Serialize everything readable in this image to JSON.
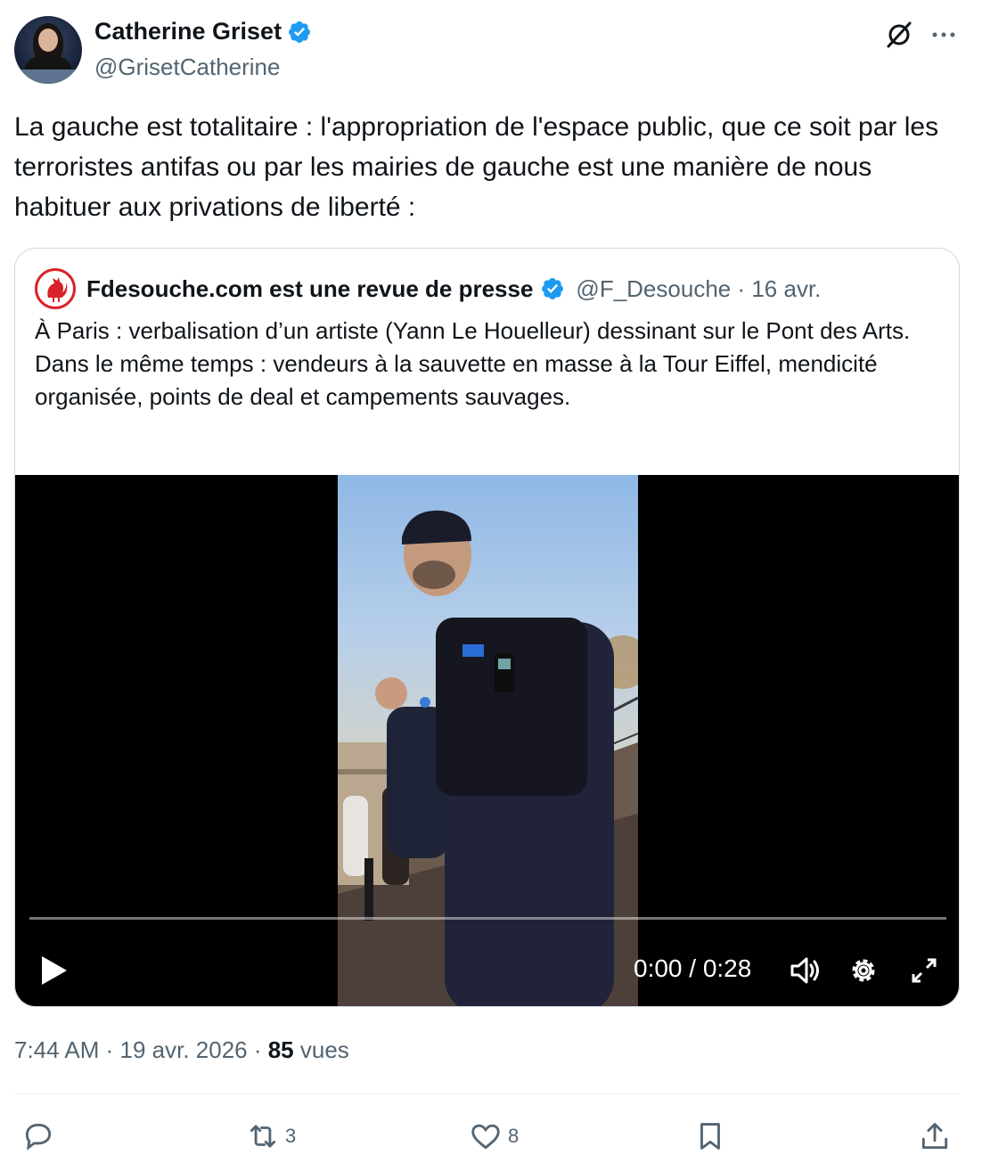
{
  "author": {
    "name": "Catherine Griset",
    "handle": "@GrisetCatherine"
  },
  "icons": {
    "verified": "verified-badge-icon",
    "grok": "grok-icon",
    "more": "more-options-icon"
  },
  "colors": {
    "verified": "#1d9bf0",
    "text_primary": "#0f1419",
    "text_secondary": "#536471",
    "border": "#cfd9de"
  },
  "tweet": {
    "text": "La gauche est totalitaire : l'appropriation de l'espace public, que ce soit par les terroristes antifas ou par les mairies de gauche est une manière de nous habituer aux privations de liberté :"
  },
  "quote": {
    "name": "Fdesouche.com est une revue de presse",
    "handle_date": "@F_Desouche · 16 avr.",
    "line1": "À Paris : verbalisation d’un artiste (Yann Le Houelleur) dessinant sur le Pont des Arts.",
    "line2": "Dans le même temps : vendeurs à la sauvette en masse à la Tour Eiffel, mendicité organisée, points de deal et campements sauvages.",
    "video": {
      "time": "0:00 / 0:28",
      "progress": 0
    }
  },
  "meta": {
    "time_date": "7:44 AM · 19 avr. 2026 · ",
    "views_count": "85",
    "views_label": " vues"
  },
  "actions": {
    "replies": "",
    "reposts": "3",
    "likes": "8"
  }
}
